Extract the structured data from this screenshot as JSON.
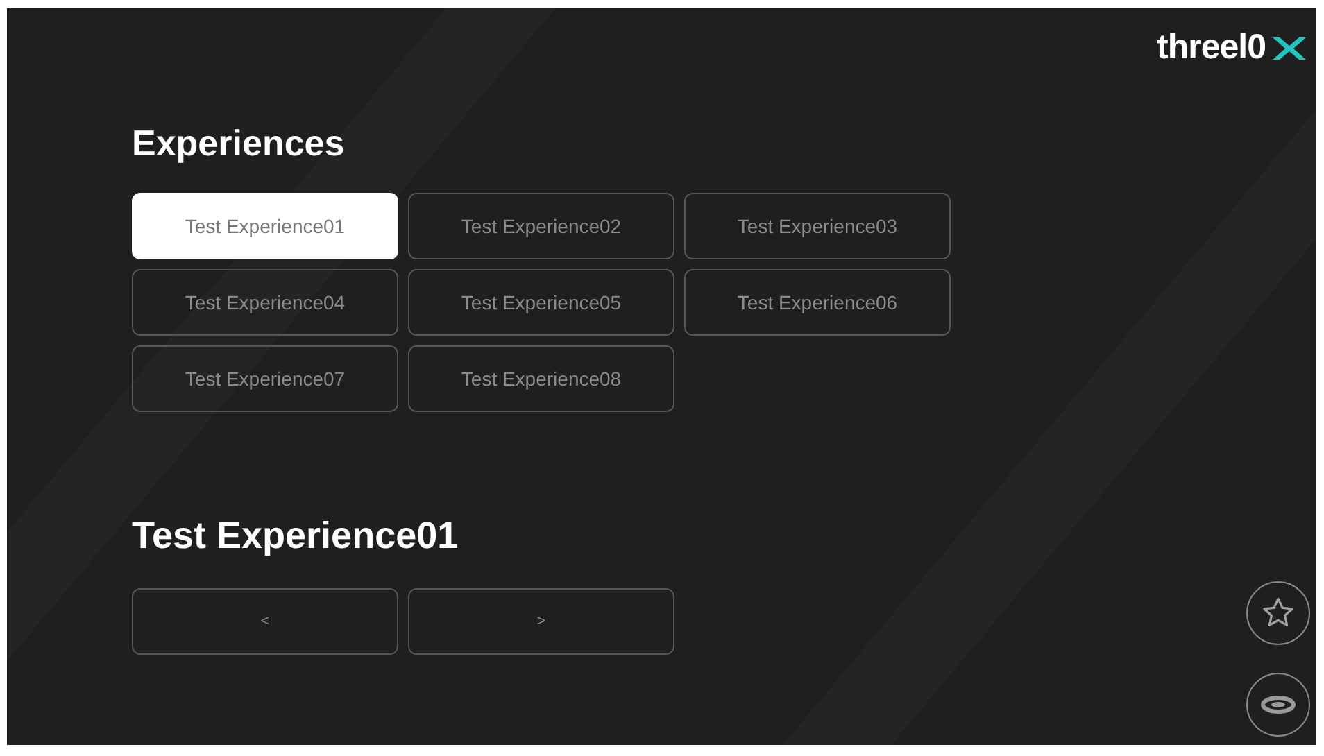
{
  "logo": {
    "text": "threel0"
  },
  "experiences": {
    "title": "Experiences",
    "items": [
      {
        "label": "Test Experience01",
        "selected": true
      },
      {
        "label": "Test Experience02",
        "selected": false
      },
      {
        "label": "Test Experience03",
        "selected": false
      },
      {
        "label": "Test Experience04",
        "selected": false
      },
      {
        "label": "Test Experience05",
        "selected": false
      },
      {
        "label": "Test Experience06",
        "selected": false
      },
      {
        "label": "Test Experience07",
        "selected": false
      },
      {
        "label": "Test Experience08",
        "selected": false
      }
    ]
  },
  "current": {
    "title": "Test Experience01",
    "nav": [
      "<",
      ">"
    ]
  }
}
